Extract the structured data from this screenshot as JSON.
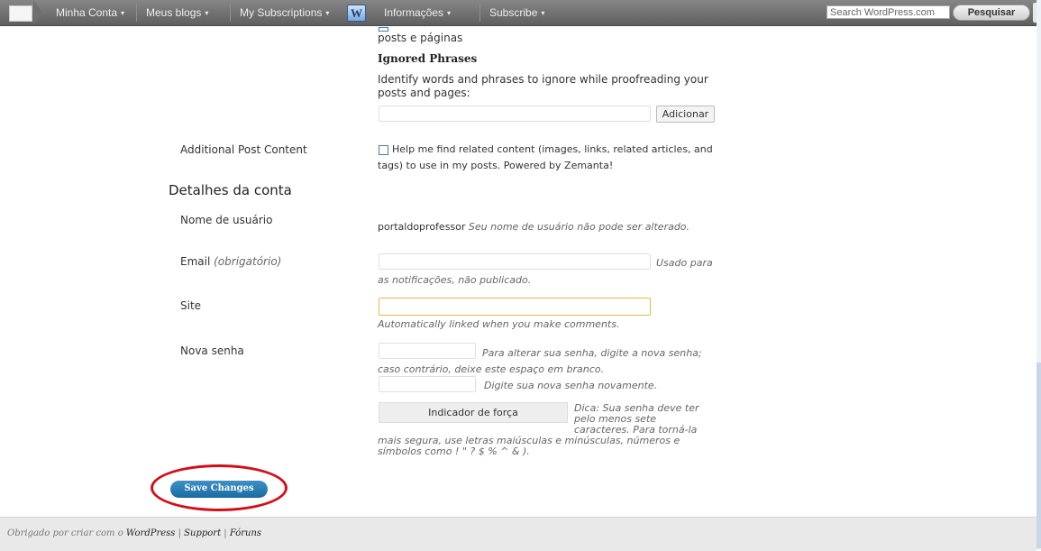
{
  "adminbar": {
    "items": [
      {
        "label": "Minha Conta",
        "caret": "▾"
      },
      {
        "label": "Meus blogs",
        "caret": "▾"
      },
      {
        "label": "My Subscriptions",
        "caret": "▾"
      },
      {
        "label": "Informações",
        "caret": "▾"
      },
      {
        "label": "Subscribe",
        "caret": "▾"
      }
    ],
    "wp_logo": "W",
    "search_placeholder": "Search WordPress.com",
    "search_button": "Pesquisar"
  },
  "proofreading": {
    "partial_text": "posts e páginas",
    "ignored_heading": "Ignored Phrases",
    "ignored_description": "Identify words and phrases to ignore while proofreading your posts and pages:",
    "add_button": "Adicionar"
  },
  "additional": {
    "label": "Additional Post Content",
    "checkbox_text": "Help me find related content (images, links, related articles, and tags) to use in my posts. Powered by Zemanta!"
  },
  "account": {
    "heading": "Detalhes da conta",
    "username_label": "Nome de usuário",
    "username_value": "portaldoprofessor",
    "username_note": "Seu nome de usuário não pode ser alterado.",
    "email_label": "Email",
    "email_required": "(obrigatório)",
    "email_note_1": "Usado para",
    "email_note_2": "as notificações, não publicado.",
    "site_label": "Site",
    "site_note": "Automatically linked when you make comments.",
    "password_label": "Nova senha",
    "password_note_1": "Para alterar sua senha, digite a nova senha;",
    "password_note_2": "caso contrário, deixe este espaço em branco.",
    "password_repeat_note": "Digite sua nova senha novamente.",
    "strength_label": "Indicador de força",
    "hint_1": "Dica: Sua senha deve ter",
    "hint_2": "pelo menos sete",
    "hint_3": "caracteres. Para torná-la",
    "hint_4": "mais segura, use letras maiúsculas e minúsculas, números e",
    "hint_5": "símbolos como ! \" ? $ % ^ & )."
  },
  "save_button": "Save Changes",
  "footer": {
    "prefix": "Obrigado por criar com o",
    "wordpress": "WordPress",
    "sep1": "|",
    "support": "Support",
    "sep2": "|",
    "forums": "Fóruns"
  },
  "colors": {
    "adminbar_bg": "#6d6d6d",
    "save_button_bg": "#2a7ab4",
    "annotation_red": "#d10f1b",
    "site_input_focus_border": "#e6b84a",
    "footer_bg": "#e9e9e9"
  }
}
